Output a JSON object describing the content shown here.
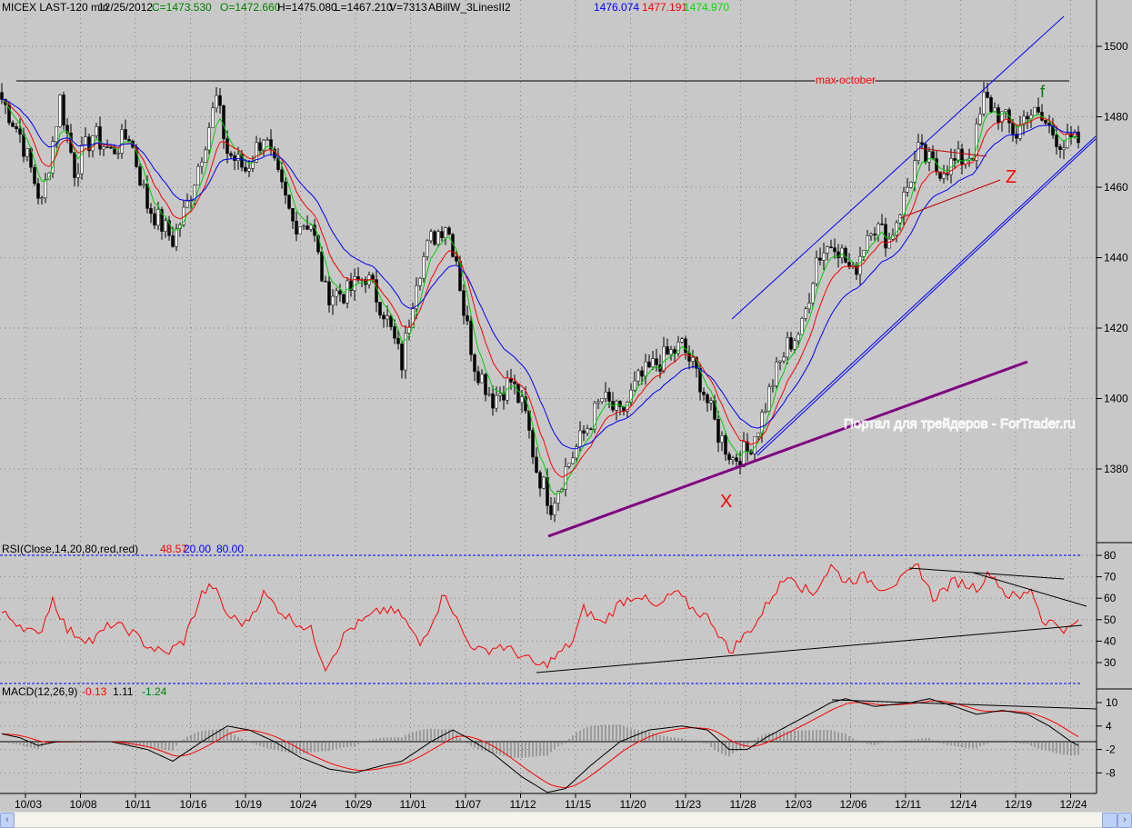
{
  "header": {
    "symbol": "MICEX LAST-120 min",
    "date": "12/25/2012",
    "close": "C=1473.530",
    "open": "O=1472.660",
    "high": "H=1475.080",
    "low": "L=1467.210",
    "volume": "V=7313",
    "indicator": "ABillW_3LinesII2",
    "line1": "1476.074",
    "line2": "1477.191",
    "line3": "1474.970"
  },
  "rsi_header": {
    "label": "RSI(Close,14,20,80,red,red)",
    "value": "48.57",
    "low": "20.00",
    "high": "80.00"
  },
  "macd_header": {
    "label": "MACD(12,26,9)",
    "value": "-0.13",
    "signal": "1.11",
    "hist": "-1.24"
  },
  "annotations": {
    "max_october": "max october",
    "x_label": "X",
    "z_label": "Z",
    "f_label": "f",
    "watermark": "Портал для трейдеров - ForTrader.ru"
  },
  "colors": {
    "bg": "#c8c8c8",
    "green": "#00c000",
    "red": "#ff0000",
    "blue": "#0000ff",
    "purple": "#800080",
    "header_green": "#008000"
  },
  "chart_data": [
    {
      "type": "candlestick",
      "title": "MICEX LAST-120 min",
      "ylim": [
        1357,
        1513
      ],
      "yticks": [
        "1380",
        "1400",
        "1420",
        "1440",
        "1460",
        "1480",
        "1500"
      ],
      "ytick_values": [
        1380,
        1400,
        1420,
        1440,
        1460,
        1480,
        1500
      ],
      "xticks": [
        "10/03",
        "10/08",
        "10/11",
        "10/16",
        "10/19",
        "10/24",
        "10/29",
        "11/01",
        "11/07",
        "11/12",
        "11/15",
        "11/20",
        "11/23",
        "11/28",
        "12/03",
        "12/06",
        "12/11",
        "12/14",
        "12/19",
        "12/24"
      ],
      "bars": 297,
      "close_keypoints": [
        [
          0,
          1485
        ],
        [
          5,
          1475
        ],
        [
          11,
          1455
        ],
        [
          16,
          1485
        ],
        [
          20,
          1465
        ],
        [
          25,
          1475
        ],
        [
          30,
          1470
        ],
        [
          35,
          1475
        ],
        [
          40,
          1455
        ],
        [
          47,
          1445
        ],
        [
          51,
          1455
        ],
        [
          55,
          1470
        ],
        [
          59,
          1485
        ],
        [
          62,
          1470
        ],
        [
          67,
          1465
        ],
        [
          72,
          1475
        ],
        [
          75,
          1465
        ],
        [
          80,
          1450
        ],
        [
          85,
          1450
        ],
        [
          89,
          1430
        ],
        [
          95,
          1430
        ],
        [
          100,
          1435
        ],
        [
          105,
          1425
        ],
        [
          110,
          1410
        ],
        [
          114,
          1435
        ],
        [
          118,
          1445
        ],
        [
          122,
          1450
        ],
        [
          125,
          1440
        ],
        [
          127,
          1425
        ],
        [
          130,
          1410
        ],
        [
          135,
          1400
        ],
        [
          140,
          1405
        ],
        [
          144,
          1395
        ],
        [
          147,
          1380
        ],
        [
          151,
          1370
        ],
        [
          155,
          1380
        ],
        [
          160,
          1390
        ],
        [
          165,
          1400
        ],
        [
          170,
          1395
        ],
        [
          175,
          1405
        ],
        [
          180,
          1410
        ],
        [
          187,
          1415
        ],
        [
          192,
          1405
        ],
        [
          197,
          1390
        ],
        [
          201,
          1383
        ],
        [
          205,
          1385
        ],
        [
          209,
          1395
        ],
        [
          212,
          1405
        ],
        [
          216,
          1415
        ],
        [
          220,
          1420
        ],
        [
          224,
          1440
        ],
        [
          229,
          1445
        ],
        [
          234,
          1435
        ],
        [
          239,
          1450
        ],
        [
          244,
          1445
        ],
        [
          249,
          1460
        ],
        [
          252,
          1470
        ],
        [
          257,
          1465
        ],
        [
          262,
          1467
        ],
        [
          267,
          1470
        ],
        [
          270,
          1485
        ],
        [
          275,
          1480
        ],
        [
          279,
          1475
        ],
        [
          282,
          1482
        ],
        [
          287,
          1478
        ],
        [
          292,
          1472
        ],
        [
          296,
          1473
        ]
      ],
      "series": [
        {
          "name": "fast MA",
          "color": "green",
          "period": 5
        },
        {
          "name": "mid MA",
          "color": "red",
          "period": 10
        },
        {
          "name": "slow MA",
          "color": "blue",
          "period": 20
        }
      ]
    },
    {
      "type": "line",
      "title": "RSI(Close,14,20,80,red,red)",
      "ylim": [
        20,
        86
      ],
      "yticks": [
        "30",
        "40",
        "50",
        "60",
        "70",
        "80"
      ],
      "ytick_values": [
        30,
        40,
        50,
        60,
        70,
        80
      ],
      "levels": [
        20,
        80
      ],
      "keypoints": [
        [
          0,
          53
        ],
        [
          5,
          48
        ],
        [
          10,
          42
        ],
        [
          14,
          60
        ],
        [
          18,
          45
        ],
        [
          25,
          40
        ],
        [
          30,
          48
        ],
        [
          35,
          45
        ],
        [
          40,
          38
        ],
        [
          45,
          34
        ],
        [
          50,
          40
        ],
        [
          55,
          62
        ],
        [
          58,
          66
        ],
        [
          62,
          52
        ],
        [
          67,
          48
        ],
        [
          72,
          62
        ],
        [
          78,
          52
        ],
        [
          85,
          45
        ],
        [
          89,
          28
        ],
        [
          95,
          45
        ],
        [
          100,
          50
        ],
        [
          105,
          55
        ],
        [
          110,
          52
        ],
        [
          115,
          38
        ],
        [
          122,
          63
        ],
        [
          125,
          50
        ],
        [
          128,
          40
        ],
        [
          132,
          35
        ],
        [
          137,
          38
        ],
        [
          142,
          34
        ],
        [
          148,
          28
        ],
        [
          152,
          32
        ],
        [
          157,
          40
        ],
        [
          160,
          55
        ],
        [
          165,
          48
        ],
        [
          170,
          58
        ],
        [
          175,
          62
        ],
        [
          180,
          55
        ],
        [
          185,
          63
        ],
        [
          190,
          55
        ],
        [
          195,
          50
        ],
        [
          200,
          35
        ],
        [
          205,
          44
        ],
        [
          208,
          50
        ],
        [
          212,
          62
        ],
        [
          217,
          72
        ],
        [
          220,
          65
        ],
        [
          223,
          62
        ],
        [
          228,
          75
        ],
        [
          232,
          68
        ],
        [
          237,
          70
        ],
        [
          242,
          65
        ],
        [
          247,
          68
        ],
        [
          252,
          75
        ],
        [
          256,
          60
        ],
        [
          262,
          68
        ],
        [
          268,
          65
        ],
        [
          272,
          72
        ],
        [
          276,
          62
        ],
        [
          280,
          60
        ],
        [
          283,
          65
        ],
        [
          286,
          50
        ],
        [
          290,
          48
        ],
        [
          293,
          45
        ],
        [
          296,
          49
        ]
      ]
    },
    {
      "type": "line",
      "title": "MACD(12,26,9)",
      "ylim": [
        -13,
        15
      ],
      "yticks": [
        "10",
        "4",
        "-2",
        "-8"
      ],
      "ytick_values": [
        10,
        4,
        -2,
        -8
      ],
      "macd_keypoints": [
        [
          0,
          2
        ],
        [
          5,
          1
        ],
        [
          10,
          -1
        ],
        [
          15,
          0
        ],
        [
          20,
          0
        ],
        [
          30,
          0
        ],
        [
          40,
          -2
        ],
        [
          47,
          -5
        ],
        [
          55,
          0
        ],
        [
          62,
          4
        ],
        [
          68,
          3
        ],
        [
          75,
          0
        ],
        [
          82,
          -4
        ],
        [
          90,
          -7
        ],
        [
          97,
          -8
        ],
        [
          105,
          -6
        ],
        [
          110,
          -5
        ],
        [
          118,
          0
        ],
        [
          124,
          3
        ],
        [
          128,
          1
        ],
        [
          135,
          -3
        ],
        [
          143,
          -9
        ],
        [
          150,
          -13
        ],
        [
          155,
          -12
        ],
        [
          162,
          -6
        ],
        [
          170,
          0
        ],
        [
          178,
          3
        ],
        [
          187,
          4
        ],
        [
          194,
          3
        ],
        [
          200,
          -2
        ],
        [
          205,
          -2
        ],
        [
          210,
          1
        ],
        [
          220,
          6
        ],
        [
          228,
          10
        ],
        [
          232,
          11
        ],
        [
          240,
          9
        ],
        [
          250,
          10
        ],
        [
          255,
          11
        ],
        [
          262,
          9
        ],
        [
          268,
          7
        ],
        [
          275,
          8
        ],
        [
          282,
          7
        ],
        [
          288,
          4
        ],
        [
          294,
          0
        ],
        [
          296,
          -1
        ]
      ],
      "signal_period": 9
    }
  ]
}
